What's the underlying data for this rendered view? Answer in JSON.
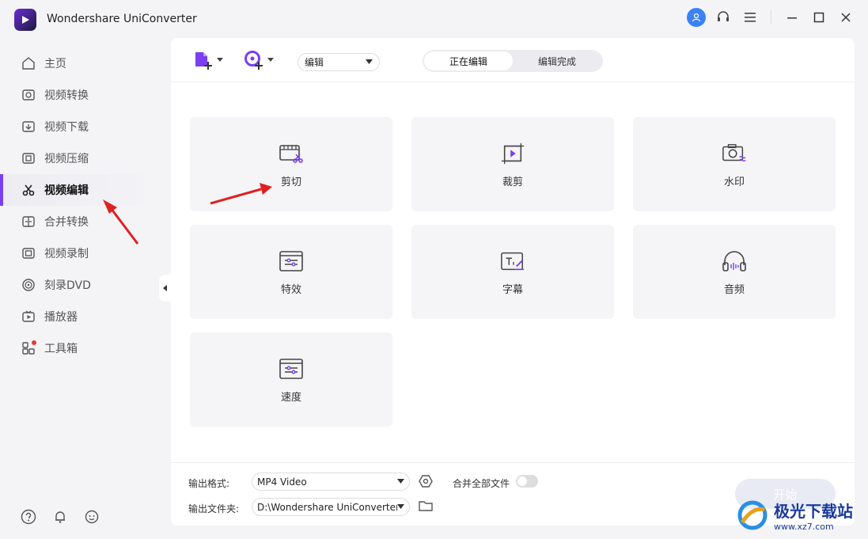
{
  "app": {
    "title": "Wondershare UniConverter"
  },
  "sidebar": {
    "items": [
      {
        "label": "主页",
        "icon": "home-icon"
      },
      {
        "label": "视频转换",
        "icon": "convert-icon"
      },
      {
        "label": "视频下载",
        "icon": "download-icon"
      },
      {
        "label": "视频压缩",
        "icon": "compress-icon"
      },
      {
        "label": "视频编辑",
        "icon": "scissors-icon",
        "active": true
      },
      {
        "label": "合并转换",
        "icon": "merge-icon"
      },
      {
        "label": "视频录制",
        "icon": "record-icon"
      },
      {
        "label": "刻录DVD",
        "icon": "dvd-icon"
      },
      {
        "label": "播放器",
        "icon": "player-icon"
      },
      {
        "label": "工具箱",
        "icon": "toolbox-icon",
        "badge": true
      }
    ]
  },
  "toolbar": {
    "mode_select": "编辑",
    "tabs": [
      {
        "label": "正在编辑",
        "active": true
      },
      {
        "label": "编辑完成",
        "active": false
      }
    ]
  },
  "cards": [
    {
      "label": "剪切",
      "icon": "trim-icon"
    },
    {
      "label": "裁剪",
      "icon": "crop-icon"
    },
    {
      "label": "水印",
      "icon": "watermark-icon"
    },
    {
      "label": "特效",
      "icon": "effects-icon"
    },
    {
      "label": "字幕",
      "icon": "subtitle-icon"
    },
    {
      "label": "音频",
      "icon": "audio-icon"
    },
    {
      "label": "速度",
      "icon": "speed-icon"
    }
  ],
  "footer": {
    "format_label": "输出格式:",
    "format_value": "MP4 Video",
    "merge_label": "合并全部文件",
    "folder_label": "输出文件夹:",
    "folder_value": "D:\\Wondershare UniConverter",
    "start_label": "开始"
  },
  "watermark": {
    "text": "极光下载站",
    "url": "www.xz7.com"
  },
  "colors": {
    "accent": "#7a3ff2",
    "arrow": "#e02020"
  }
}
